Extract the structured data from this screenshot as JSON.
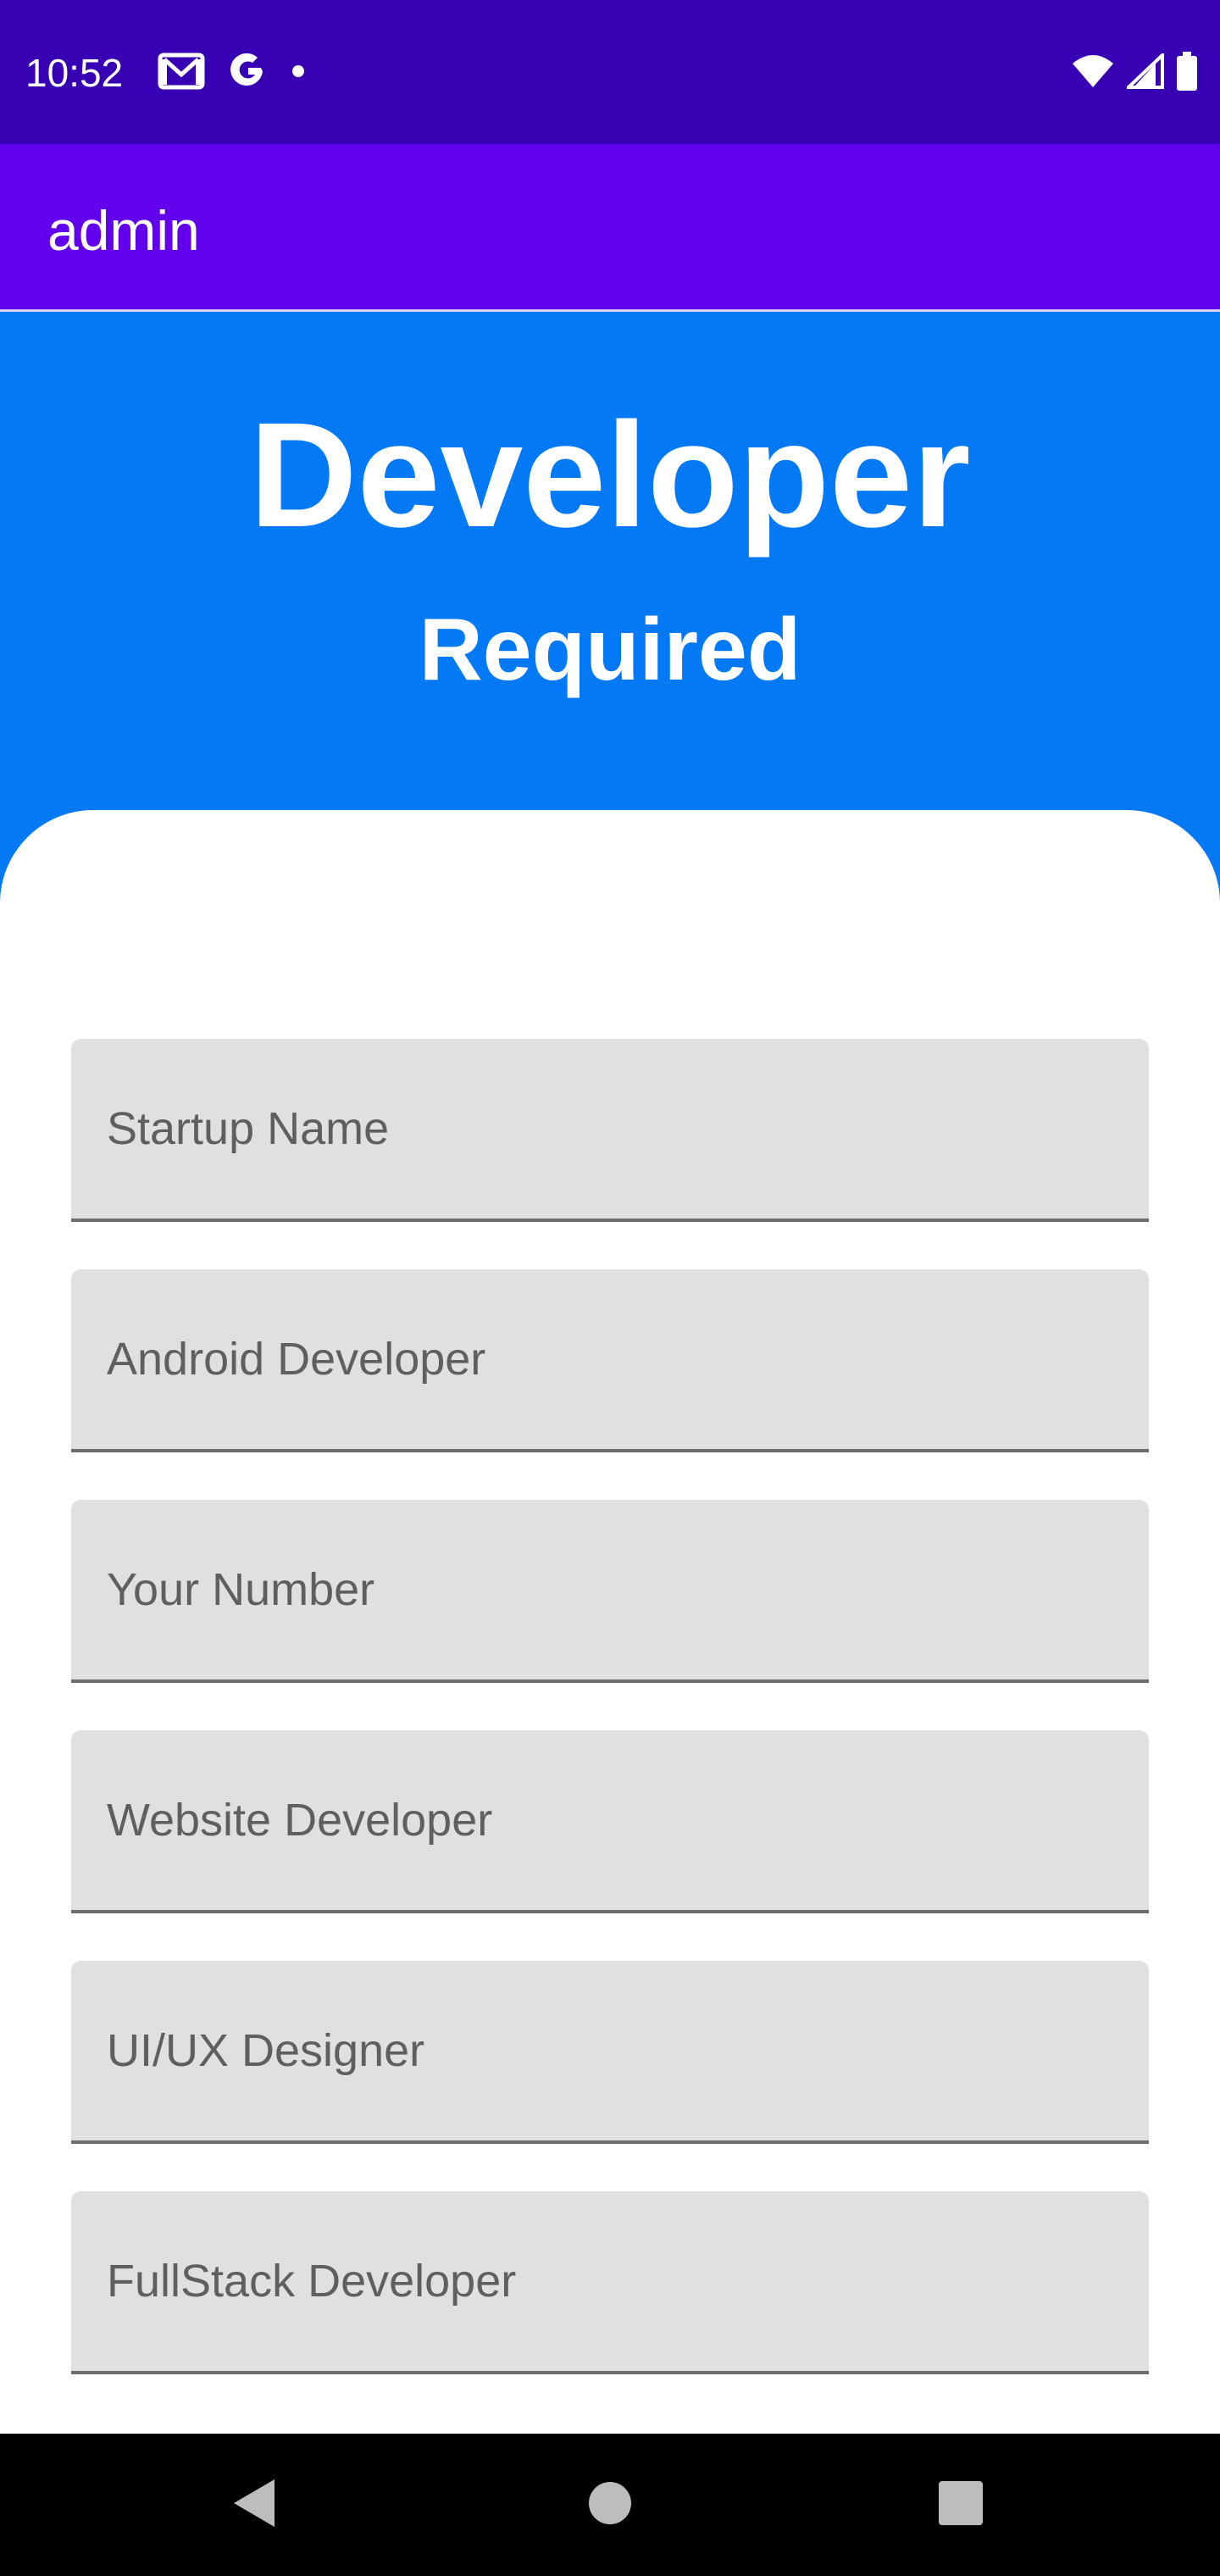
{
  "status_bar": {
    "time": "10:52",
    "icons_left": [
      "gmail-icon",
      "google-icon",
      "notification-dot-icon"
    ],
    "icons_right": [
      "wifi-icon",
      "cell-signal-icon",
      "battery-icon"
    ]
  },
  "app_bar": {
    "title": "admin"
  },
  "hero": {
    "title": "Developer",
    "subtitle": "Required"
  },
  "form": {
    "fields": [
      {
        "placeholder": "Startup Name"
      },
      {
        "placeholder": "Android Developer"
      },
      {
        "placeholder": "Your Number"
      },
      {
        "placeholder": "Website Developer"
      },
      {
        "placeholder": "UI/UX Designer"
      },
      {
        "placeholder": "FullStack Developer"
      }
    ]
  },
  "nav_bar": {
    "buttons": [
      "back-icon",
      "home-icon",
      "recents-icon"
    ]
  },
  "colors": {
    "status_bar": "#3700B3",
    "app_bar": "#6200EE",
    "hero": "#0379F6",
    "field_bg": "#E0E0E0"
  }
}
